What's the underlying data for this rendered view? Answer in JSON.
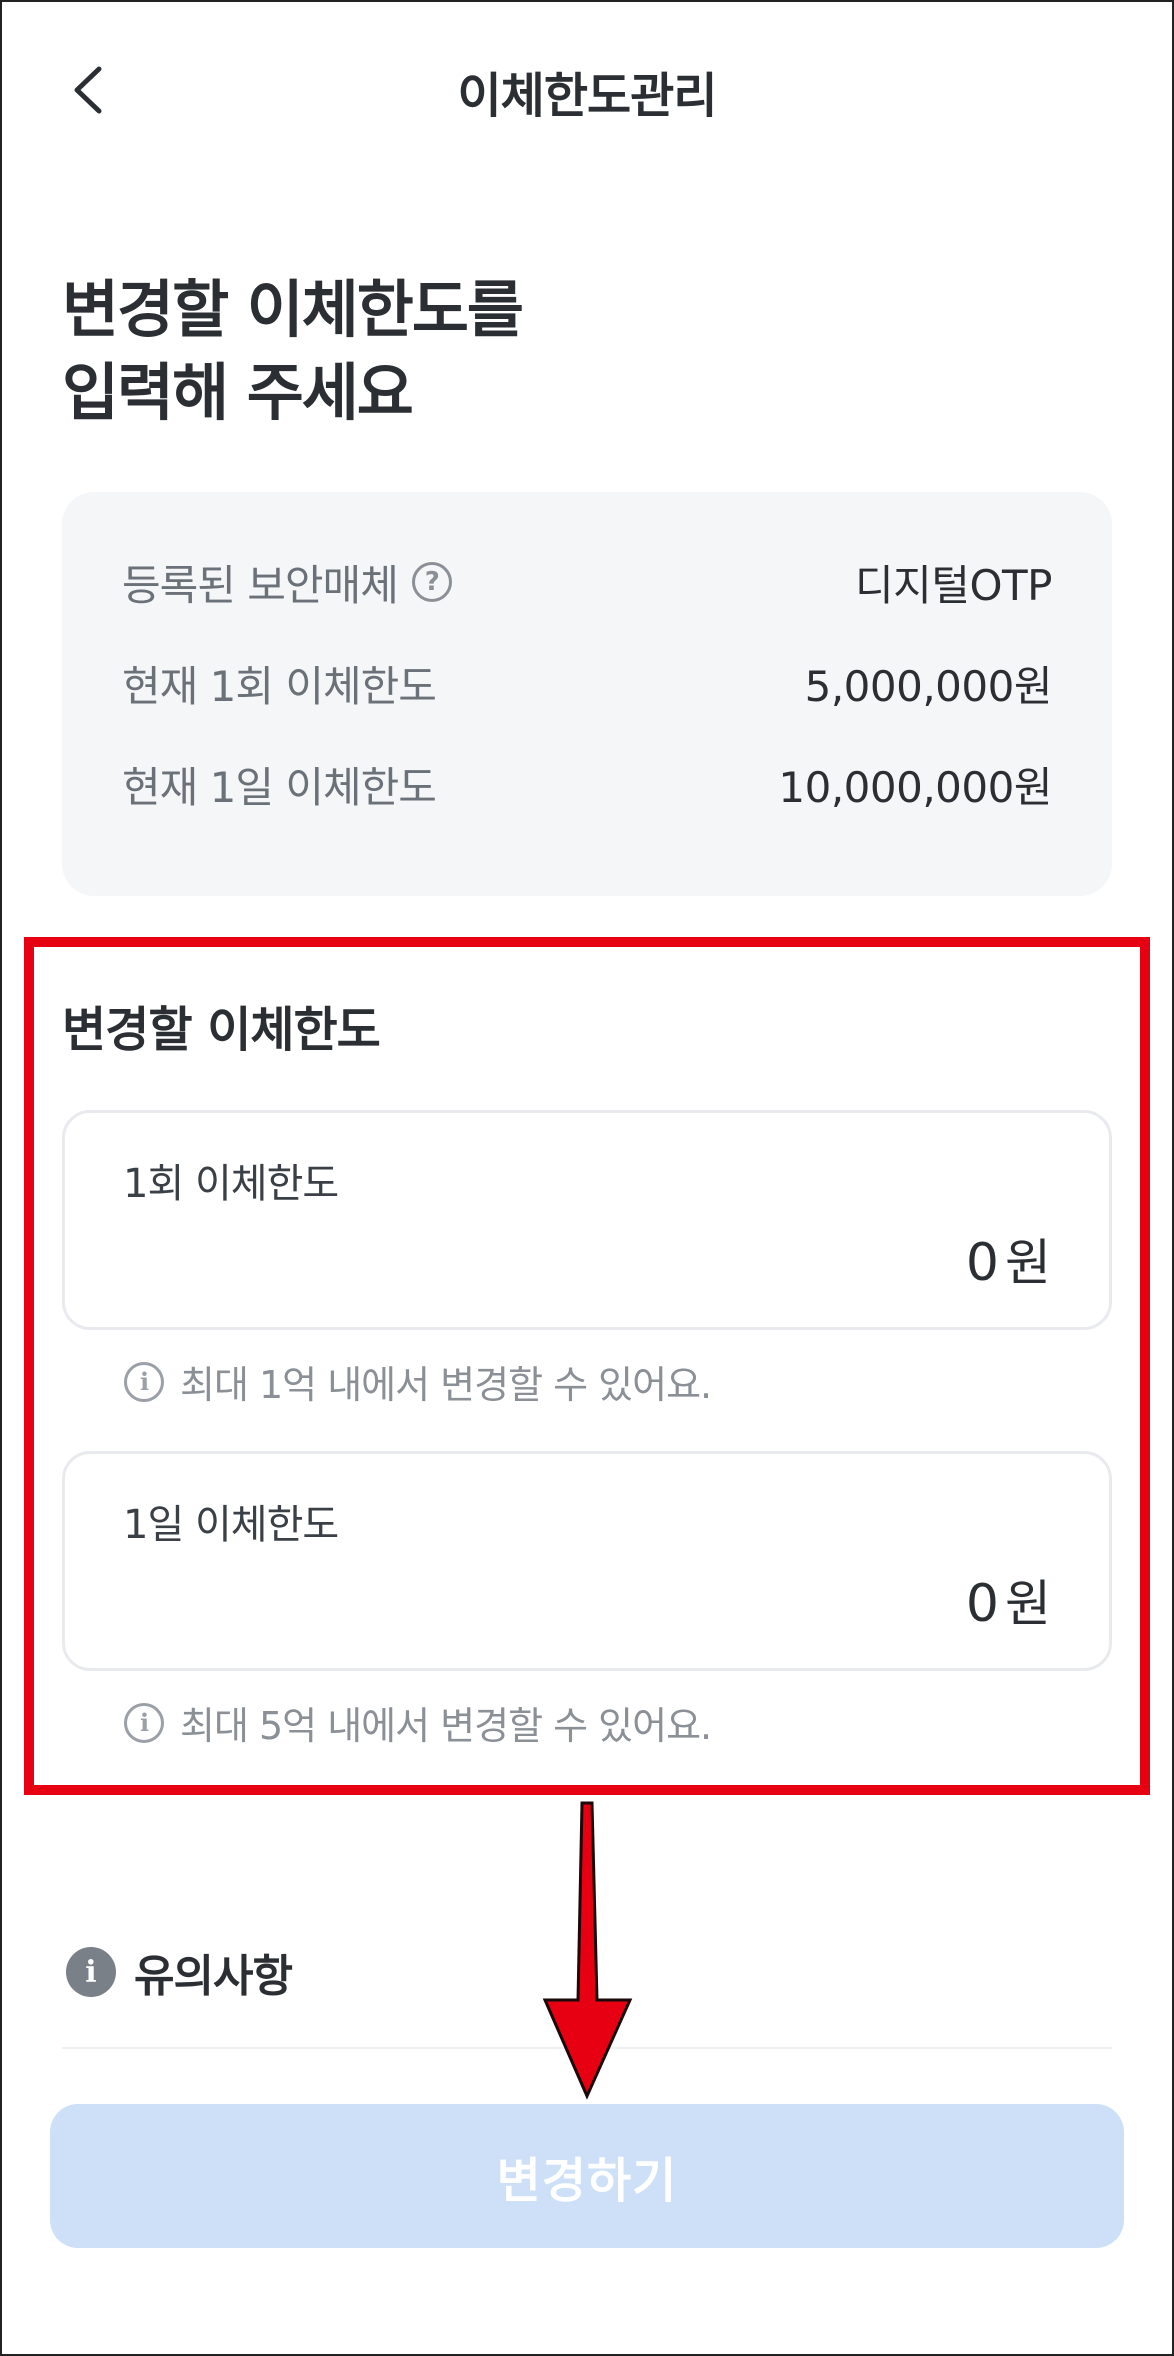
{
  "header": {
    "title": "이체한도관리"
  },
  "headline": {
    "line1": "변경할 이체한도를",
    "line2": "입력해 주세요"
  },
  "current_info": {
    "security_media_label": "등록된 보안매체",
    "security_media_value": "디지털OTP",
    "per_transfer_label": "현재 1회 이체한도",
    "per_transfer_value": "5,000,000원",
    "daily_label": "현재 1일 이체한도",
    "daily_value": "10,000,000원"
  },
  "change_section": {
    "title": "변경할 이체한도",
    "per_transfer": {
      "label": "1회 이체한도",
      "value": "0",
      "unit": "원",
      "hint": "최대 1억 내에서 변경할 수 있어요."
    },
    "daily": {
      "label": "1일 이체한도",
      "value": "0",
      "unit": "원",
      "hint": "최대 5억 내에서 변경할 수 있어요."
    }
  },
  "notice": {
    "label": "유의사항"
  },
  "submit_button": {
    "label": "변경하기"
  },
  "colors": {
    "annotation_red": "#e60012",
    "button_disabled_bg": "#cde0f8",
    "card_bg": "#f5f6f7"
  },
  "icons": {
    "back": "chevron-left-icon",
    "help": "question-circle-icon",
    "info": "info-circle-icon",
    "notice": "info-filled-icon"
  }
}
